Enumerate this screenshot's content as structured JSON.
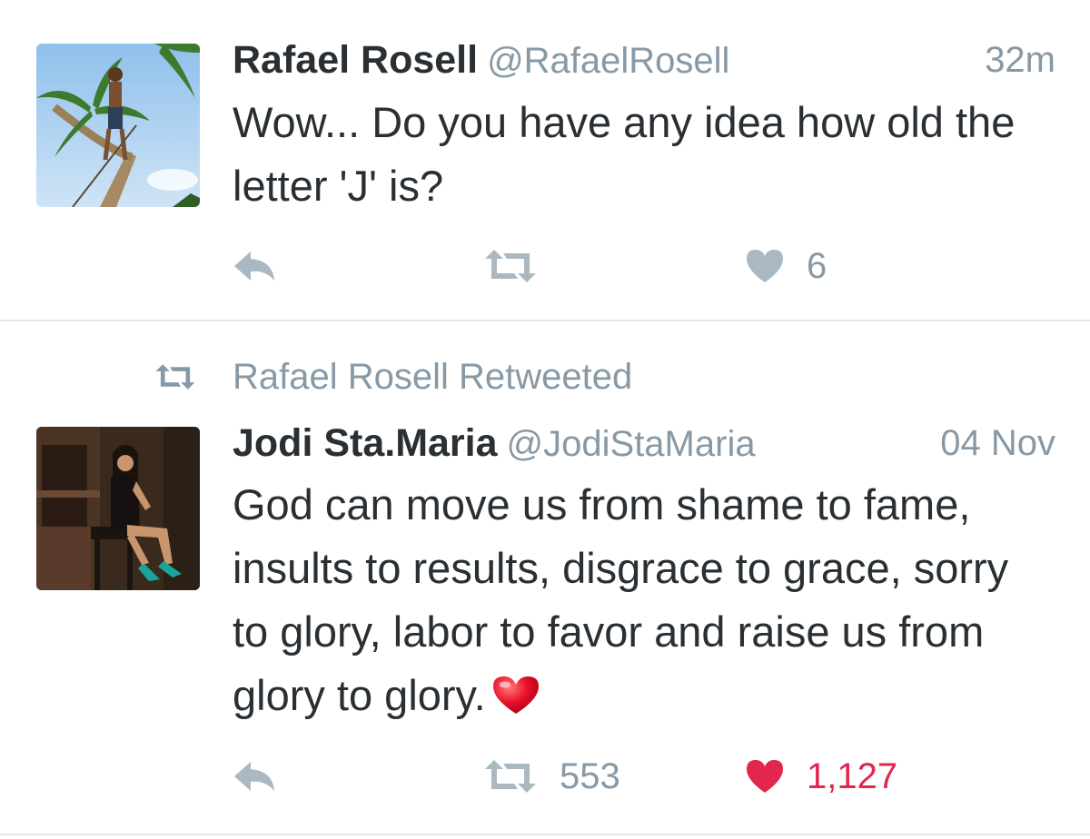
{
  "tweets": [
    {
      "display_name": "Rafael Rosell",
      "handle": "@RafaelRosell",
      "time": "32m",
      "text": "Wow... Do you have any idea how old the letter 'J' is?",
      "avatar_icon": "palm-tree-climber-photo",
      "reply_count": "",
      "retweet_count": "",
      "like_count": "6",
      "liked": false
    },
    {
      "retweet_context": "Rafael Rosell Retweeted",
      "display_name": "Jodi Sta.Maria",
      "handle": "@JodiStaMaria",
      "time": "04 Nov",
      "text": "God can move us from shame to fame, insults to results, disgrace to grace, sorry to glory, labor to favor and raise us from glory to glory.",
      "trailing_emoji": "red-heart-emoji",
      "avatar_icon": "woman-seated-by-piano-photo",
      "reply_count": "",
      "retweet_count": "553",
      "like_count": "1,127",
      "liked": true
    }
  ],
  "colors": {
    "text": "#292f33",
    "secondary": "#8899a6",
    "icon": "#aab8c2",
    "like_active": "#e2264d",
    "divider": "#e1e8ed"
  }
}
